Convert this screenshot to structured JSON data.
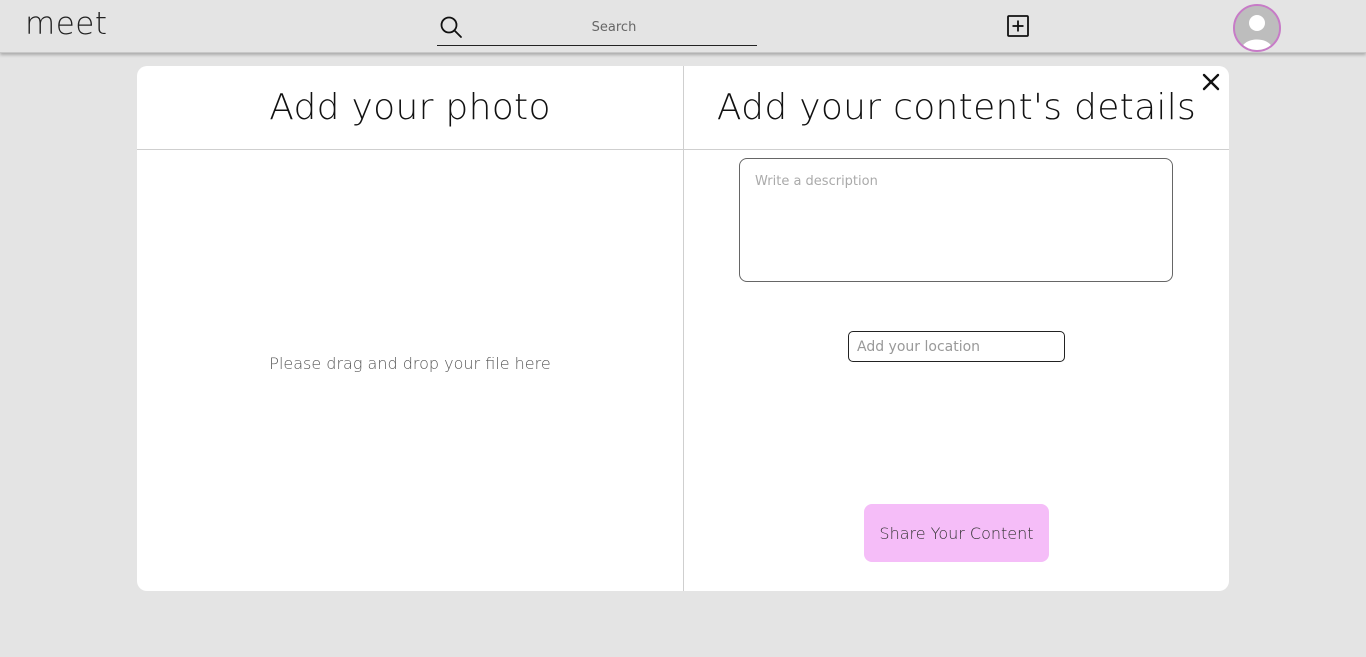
{
  "app": {
    "logo": "meet"
  },
  "header": {
    "search_placeholder": "Search",
    "search_icon": "search-icon",
    "add_post_icon": "plus-square-icon",
    "avatar_icon": "user-avatar-icon"
  },
  "modal": {
    "left_title": "Add your photo",
    "right_title": "Add your content's details",
    "dropzone_text": "Please drag and drop your file here",
    "description_placeholder": "Write a description",
    "location_placeholder": "Add your location",
    "share_label": "Share Your Content",
    "close_icon": "close-icon"
  },
  "colors": {
    "background": "#e4e4e4",
    "modal_bg": "#ffffff",
    "share_button_bg": "#f5bdf8",
    "avatar_ring": "#c77bc7"
  }
}
